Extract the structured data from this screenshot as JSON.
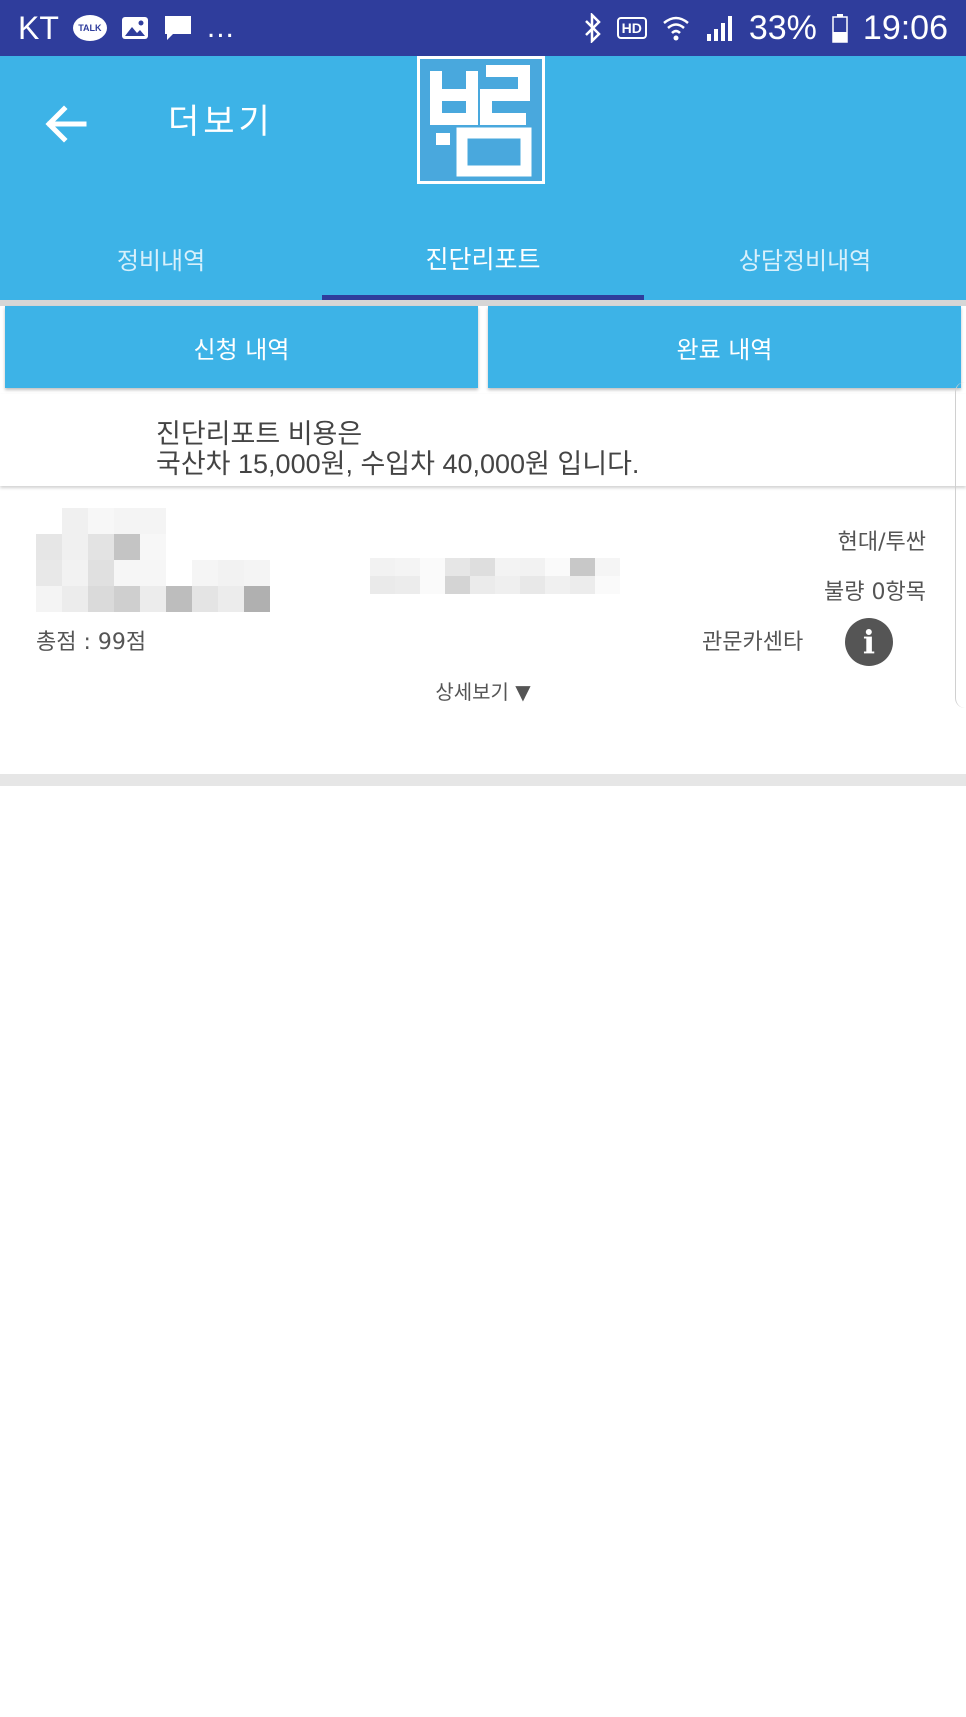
{
  "status_bar": {
    "carrier": "KT",
    "talk_icon_text": "TALK",
    "more": "...",
    "battery": "33%",
    "time": "19:06",
    "hd": "HD",
    "icons": [
      "kakaotalk-icon",
      "image-icon",
      "message-icon",
      "bluetooth-icon",
      "hd-icon",
      "wifi-icon",
      "signal-icon",
      "battery-icon"
    ]
  },
  "appbar": {
    "title": "더보기",
    "logo_text": "브름",
    "background": "#3db3e7"
  },
  "tabs": [
    {
      "label": "정비내역",
      "active": false
    },
    {
      "label": "진단리포트",
      "active": true
    },
    {
      "label": "상담정비내역",
      "active": false
    }
  ],
  "sub_buttons": {
    "request": "신청 내역",
    "complete": "완료 내역"
  },
  "notice": {
    "line1": "진단리포트 비용은",
    "line2": "국산차 15,000원, 수입차 40,000원 입니다."
  },
  "report": {
    "car_model": "현대/투싼",
    "defects": "불량 0항목",
    "total_score": "총점 : 99점",
    "center": "관문카센타",
    "detail_label": "상세보기 ▼",
    "info_icon": "i"
  },
  "colors": {
    "status_bar": "#2f3d9c",
    "accent": "#3db3e7",
    "tab_indicator": "#2f3d9c",
    "info_icon": "#555555"
  }
}
